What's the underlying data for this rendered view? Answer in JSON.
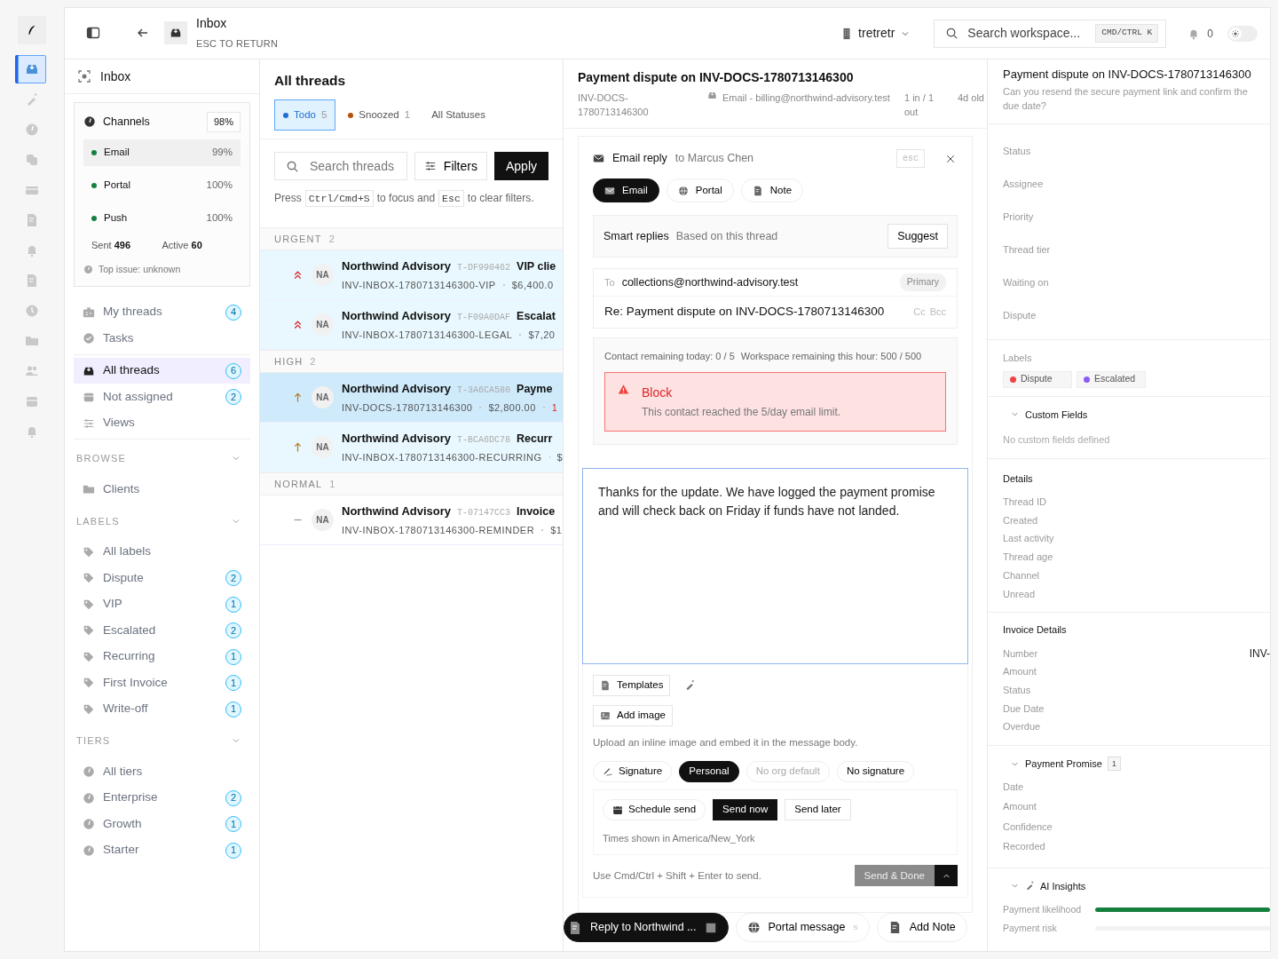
{
  "rail": [
    {
      "selected": true
    },
    {
      "selected": false
    },
    {
      "selected": false
    },
    {
      "selected": false
    },
    {
      "selected": false
    },
    {
      "selected": false
    },
    {
      "selected": false
    },
    {
      "selected": false
    },
    {
      "selected": false
    },
    {
      "selected": false
    },
    {
      "selected": false
    },
    {
      "selected": false
    },
    {
      "selected": false
    }
  ],
  "header": {
    "title": "Inbox",
    "subtitle": "ESC TO RETURN",
    "workspace": "tretretr",
    "search": {
      "placeholder": "Search workspace...",
      "shortcut": "CMD/CTRL K"
    },
    "notifications": "0",
    "theme_toggle": {
      "on": false
    }
  },
  "sidebar": {
    "title": "Inbox",
    "channels": {
      "title": "Channels",
      "score": "98%",
      "items": [
        {
          "name": "Email",
          "value": "99%",
          "color": "#15803d",
          "selected": true
        },
        {
          "name": "Portal",
          "value": "100%",
          "color": "#15803d",
          "selected": false
        },
        {
          "name": "Push",
          "value": "100%",
          "color": "#15803d",
          "selected": false
        }
      ],
      "stats": [
        {
          "label": "Sent",
          "value": "496"
        },
        {
          "label": "Active",
          "value": "60"
        }
      ],
      "top_issue": "Top issue: unknown"
    },
    "nav": [
      {
        "label": "My threads",
        "count": "4",
        "selected": false
      },
      {
        "label": "Tasks",
        "selected": false
      },
      {
        "label": "All threads",
        "count": "6",
        "selected": true
      },
      {
        "label": "Not assigned",
        "count": "2",
        "selected": false
      },
      {
        "label": "Views",
        "selected": false
      }
    ],
    "sections": [
      {
        "title": "BROWSE",
        "expanded": true,
        "items": [
          {
            "label": "Clients",
            "selected": false
          }
        ]
      },
      {
        "title": "LABELS",
        "expanded": true,
        "items": [
          {
            "label": "All labels",
            "selected": false
          },
          {
            "label": "Dispute",
            "count": "2",
            "selected": false
          },
          {
            "label": "VIP",
            "count": "1",
            "selected": false
          },
          {
            "label": "Escalated",
            "count": "2",
            "selected": false
          },
          {
            "label": "Recurring",
            "count": "1",
            "selected": false
          },
          {
            "label": "First Invoice",
            "count": "1",
            "selected": false
          },
          {
            "label": "Write-off",
            "count": "1",
            "selected": false
          }
        ]
      },
      {
        "title": "TIERS",
        "expanded": true,
        "items": [
          {
            "label": "All tiers",
            "selected": false
          },
          {
            "label": "Enterprise",
            "count": "2",
            "selected": false
          },
          {
            "label": "Growth",
            "count": "1",
            "selected": false
          },
          {
            "label": "Starter",
            "count": "1",
            "selected": false
          }
        ]
      }
    ]
  },
  "thread_list": {
    "title": "All threads",
    "statuses": [
      {
        "label": "Todo",
        "count": "5",
        "color": "#1e6fd0",
        "selected": true
      },
      {
        "label": "Snoozed",
        "count": "1",
        "color": "#b45309",
        "selected": false
      },
      {
        "label": "All Statuses",
        "selected": false
      }
    ],
    "search": {
      "placeholder": "Search threads"
    },
    "filters_button": "Filters",
    "apply_button": "Apply",
    "hint": [
      {
        "kind": "text",
        "text": "Press"
      },
      {
        "kind": "key",
        "text": "Ctrl/Cmd+S"
      },
      {
        "kind": "text",
        "text": "to focus and"
      },
      {
        "kind": "key",
        "text": "Esc"
      },
      {
        "kind": "text",
        "text": "to clear filters."
      }
    ],
    "groups": [
      {
        "label": "URGENT",
        "count": "2",
        "threads": [
          {
            "kind": "urgent",
            "avatar": "NA",
            "name": "Northwind Advisory",
            "id": "T-DF990462",
            "subject": "VIP clie",
            "invoice": "INV-INBOX-1780713146300-VIP",
            "amount": "$6,400.0",
            "selected": false,
            "highlighted": true
          },
          {
            "kind": "urgent",
            "avatar": "NA",
            "name": "Northwind Advisory",
            "id": "T-F09A0DAF",
            "subject": "Escalat",
            "invoice": "INV-INBOX-1780713146300-LEGAL",
            "amount": "$7,20",
            "selected": false,
            "highlighted": true
          }
        ]
      },
      {
        "label": "HIGH",
        "count": "2",
        "threads": [
          {
            "kind": "high",
            "avatar": "NA",
            "name": "Northwind Advisory",
            "id": "T-3A6CA580",
            "subject": "Payme",
            "invoice": "INV-DOCS-1780713146300",
            "amount": "$2,800.00",
            "extra": "1",
            "selected": true,
            "highlighted": true
          },
          {
            "kind": "high",
            "avatar": "NA",
            "name": "Northwind Advisory",
            "id": "T-BCA6DC78",
            "subject": "Recurr",
            "invoice": "INV-INBOX-1780713146300-RECURRING",
            "amount": "$",
            "selected": false,
            "highlighted": true
          }
        ]
      },
      {
        "label": "NORMAL",
        "count": "1",
        "threads": [
          {
            "kind": "normal",
            "avatar": "NA",
            "name": "Northwind Advisory",
            "id": "T-07147CC3",
            "subject": "Invoice",
            "invoice": "INV-INBOX-1780713146300-REMINDER",
            "amount": "$1",
            "selected": false,
            "highlighted": false
          }
        ]
      }
    ]
  },
  "detail": {
    "title": "Payment dispute on INV-DOCS-1780713146300",
    "meta": [
      "INV-DOCS-1780713146300",
      "Email - billing@northwind-advisory.test",
      "1 in / 1 out",
      "4d old"
    ],
    "composer": {
      "title": "Email reply",
      "recipient": "to Marcus Chen",
      "esc": "esc",
      "modes": [
        {
          "label": "Email",
          "selected": true
        },
        {
          "label": "Portal",
          "selected": false
        },
        {
          "label": "Note",
          "selected": false
        }
      ],
      "smart_replies": {
        "title": "Smart replies",
        "subtitle": "Based on this thread",
        "button": "Suggest"
      },
      "to": {
        "label": "To",
        "address": "collections@northwind-advisory.test",
        "badge": "Primary"
      },
      "subject": "Re: Payment dispute on INV-DOCS-1780713146300",
      "cc": "Cc",
      "bcc": "Bcc",
      "limits": [
        "Contact remaining today: 0 / 5",
        "Workspace remaining this hour: 500 / 500"
      ],
      "alert": {
        "title": "Block",
        "text": "This contact reached the 5/day email limit."
      },
      "body": "Thanks for the update. We have logged the payment promise and will check back on Friday if funds have not landed.",
      "templates_button": "Templates",
      "add_image_button": "Add image",
      "image_hint": "Upload an inline image and embed it in the message body.",
      "signature_label": "Signature",
      "signatures": [
        {
          "label": "Personal",
          "selected": true,
          "disabled": false
        },
        {
          "label": "No org default",
          "selected": false,
          "disabled": true
        },
        {
          "label": "No signature",
          "selected": false,
          "disabled": false
        }
      ],
      "schedule_label": "Schedule send",
      "schedule": [
        {
          "label": "Send now",
          "selected": true
        },
        {
          "label": "Send later",
          "selected": false
        }
      ],
      "timezone": "Times shown in America/New_York",
      "send_hint": "Use Cmd/Ctrl + Shift + Enter to send.",
      "send_button": {
        "label": "Send & Done",
        "disabled": true
      }
    },
    "actions": [
      {
        "kind": "primary",
        "label": "Reply to Northwind ..."
      },
      {
        "kind": "secondary",
        "label": "Portal message",
        "key": "S"
      },
      {
        "kind": "secondary",
        "label": "Add Note"
      }
    ]
  },
  "info": {
    "title": "Payment dispute on INV-DOCS-1780713146300",
    "summary": "Can you resend the secure payment link and confirm the due date?",
    "fields": [
      {
        "label": "Status"
      },
      {
        "label": "Assignee"
      },
      {
        "label": "Priority"
      },
      {
        "label": "Thread tier"
      },
      {
        "label": "Waiting on"
      },
      {
        "label": "Dispute"
      }
    ],
    "labels_title": "Labels",
    "labels": [
      {
        "label": "Dispute",
        "color": "#ef4444"
      },
      {
        "label": "Escalated",
        "color": "#8b5cf6"
      }
    ],
    "custom_fields": {
      "title": "Custom Fields",
      "expanded": true,
      "empty": "No custom fields defined"
    },
    "details": {
      "title": "Details",
      "fields": [
        {
          "label": "Thread ID"
        },
        {
          "label": "Created"
        },
        {
          "label": "Last activity"
        },
        {
          "label": "Thread age"
        },
        {
          "label": "Channel"
        },
        {
          "label": "Unread"
        }
      ]
    },
    "invoice": {
      "title": "Invoice Details",
      "fields": [
        {
          "label": "Number",
          "value": "INV-"
        },
        {
          "label": "Amount"
        },
        {
          "label": "Status"
        },
        {
          "label": "Due Date"
        },
        {
          "label": "Overdue"
        }
      ]
    },
    "promise": {
      "title": "Payment Promise",
      "count": "1",
      "expanded": true,
      "fields": [
        {
          "label": "Date"
        },
        {
          "label": "Amount"
        },
        {
          "label": "Confidence"
        },
        {
          "label": "Recorded"
        }
      ]
    },
    "insights": {
      "title": "AI Insights",
      "expanded": true,
      "metrics": [
        {
          "label": "Payment likelihood",
          "level": 1.0
        },
        {
          "label": "Payment risk",
          "level": 0.0
        }
      ]
    }
  }
}
